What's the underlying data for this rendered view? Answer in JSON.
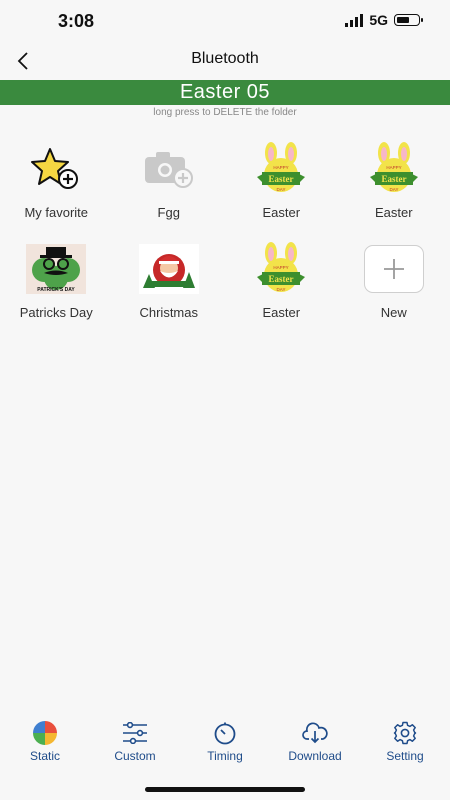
{
  "status": {
    "time": "3:08",
    "network": "5G"
  },
  "nav": {
    "title": "Bluetooth"
  },
  "folder": {
    "name": "Easter 05",
    "hint": "long press to DELETE the folder"
  },
  "grid": {
    "items": [
      {
        "label": "My favorite",
        "icon": "star-add-icon"
      },
      {
        "label": "Fgg",
        "icon": "camera-add-icon"
      },
      {
        "label": "Easter",
        "icon": "easter-bunny-image",
        "image_text": [
          "HAPPY",
          "Easter",
          "DAY"
        ]
      },
      {
        "label": "Easter",
        "icon": "easter-bunny-image",
        "image_text": [
          "HAPPY",
          "Easter",
          "DAY"
        ]
      },
      {
        "label": "Patricks Day",
        "icon": "patricks-day-image",
        "image_text": [
          "PATRICK'S DAY"
        ]
      },
      {
        "label": "Christmas",
        "icon": "christmas-santa-image"
      },
      {
        "label": "Easter",
        "icon": "easter-bunny-image",
        "image_text": [
          "HAPPY",
          "Easter",
          "DAY"
        ]
      },
      {
        "label": "New",
        "icon": "plus-icon"
      }
    ]
  },
  "tabs": [
    {
      "label": "Static",
      "icon": "color-wheel-icon"
    },
    {
      "label": "Custom",
      "icon": "sliders-icon"
    },
    {
      "label": "Timing",
      "icon": "timer-icon"
    },
    {
      "label": "Download",
      "icon": "cloud-download-icon"
    },
    {
      "label": "Setting",
      "icon": "gear-icon"
    }
  ],
  "colors": {
    "banner": "#3a8a3e",
    "tab_accent": "#1f4c8a",
    "background": "#f7f7f7"
  }
}
